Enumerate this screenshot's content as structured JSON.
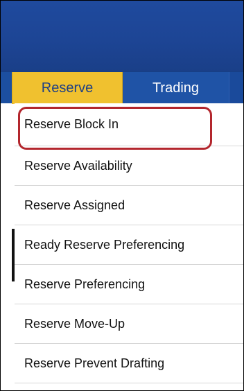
{
  "tabs": [
    {
      "label": "Reserve",
      "active": true
    },
    {
      "label": "Trading",
      "active": false
    }
  ],
  "menu": {
    "items": [
      {
        "label": "Reserve Block In",
        "highlighted": true
      },
      {
        "label": "Reserve Availability"
      },
      {
        "label": "Reserve Assigned"
      },
      {
        "label": "Ready Reserve Preferencing"
      },
      {
        "label": "Reserve Preferencing"
      },
      {
        "label": "Reserve Move-Up"
      },
      {
        "label": "Reserve Prevent Drafting"
      }
    ]
  },
  "colors": {
    "header_blue": "#1d4595",
    "active_tab": "#f0c12f",
    "active_tab_text": "#1d3f86",
    "highlight_outline": "#b3262d"
  }
}
